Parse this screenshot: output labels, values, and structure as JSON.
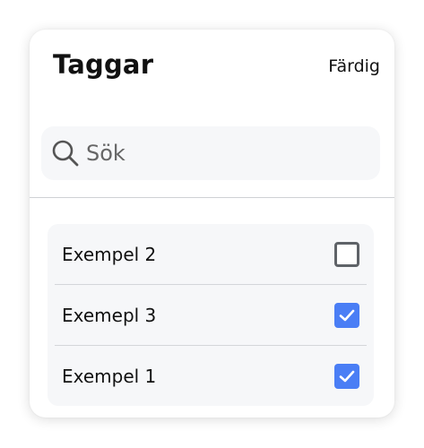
{
  "header": {
    "title": "Taggar",
    "done_label": "Färdig"
  },
  "search": {
    "placeholder": "Sök",
    "value": ""
  },
  "tags": [
    {
      "label": "Exempel 2",
      "checked": false
    },
    {
      "label": "Exemepl 3",
      "checked": true
    },
    {
      "label": "Exempel 1",
      "checked": true
    }
  ],
  "colors": {
    "accent": "#4a7ef5",
    "surface": "#f6f7f9",
    "divider": "#cfd1d5",
    "text": "#111111"
  },
  "icons": {
    "search": "search-icon",
    "checked": "checkmark-icon"
  }
}
